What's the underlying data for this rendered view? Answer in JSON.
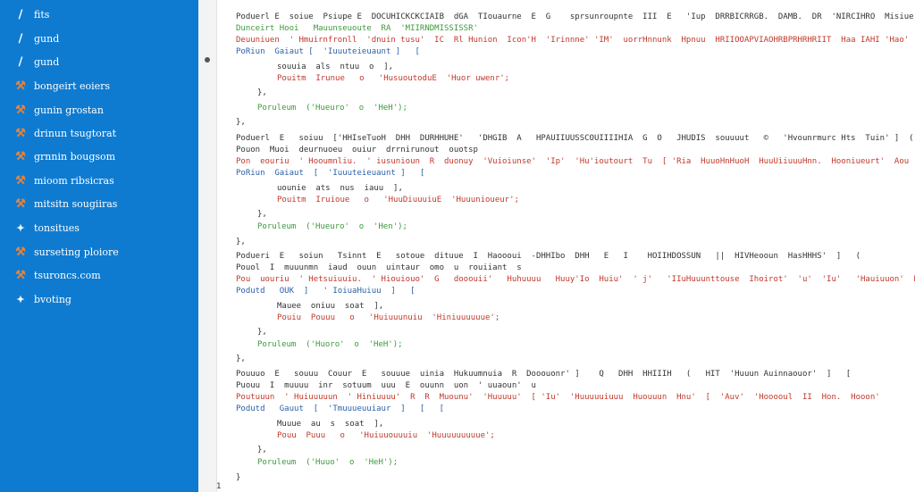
{
  "sidebar": {
    "items": [
      {
        "label": "fits",
        "icon": "pen-icon"
      },
      {
        "label": "gund",
        "icon": "pen-icon"
      },
      {
        "label": "gund",
        "icon": "pen-icon"
      },
      {
        "label": "bongeirt eoiers",
        "icon": "tool-icon"
      },
      {
        "label": "gunin grostan",
        "icon": "tool-icon"
      },
      {
        "label": "drinun tsugtorat",
        "icon": "tool-icon"
      },
      {
        "label": "grnnin bougsom",
        "icon": "tool-icon"
      },
      {
        "label": "mioom ribsicras",
        "icon": "tool-icon"
      },
      {
        "label": "mitsitn sougiiras",
        "icon": "tool-icon"
      },
      {
        "label": "tonsitues",
        "icon": "star-icon"
      },
      {
        "label": "surseting ploiore",
        "icon": "tool-icon"
      },
      {
        "label": "tsuroncs.com",
        "icon": "tool-icon"
      },
      {
        "label": "bvoting",
        "icon": "star-icon"
      }
    ]
  },
  "gutter": {
    "end_marker": "1"
  },
  "code": {
    "block1": {
      "l1": "Poduerl E  soiue  Psiupe E  DOCUHICKCKCIAIB  dGA  TIouaurne  E  G    sprsunroupnte  III  E   'Iup  DRRBICRRGB.  DAMB.  DR  'NIRCIHRO  Misiue - RAUT' I",
      "l2": "Dunceirt Hooi   Mauunseuoute  RA  'MIIRNDMISSISSR'",
      "l3": "Deuuniuen  ' Hmuirnfronll  'dnuin tusu'  IC  Rl Hunion  Icon'H  'Irinnne' 'IM'  uorrHnnunk  Hpnuu  HRIIOOAPVIAOHRBPRHRHRIIT  Haa IAHI 'Hao'  'Maooionrom' 'Ip' 'Hun'  Heirt  Bwwnn",
      "l4": "PoRiun  Gaiaut [  'Iuuuteieuaunt ]   [",
      "l5": "souuia  als  ntuu  o  ],",
      "l6": "Pouitm  Irunue   o   'HusuoutoduE  'Huor uwenr';",
      "l7": "},",
      "l8": "Poruleum  ('Hueuro'  o  'HeH');",
      "l9": "},"
    },
    "block2": {
      "l1": "Poduerl  E   soiuu  ['HHIseTuoH  DHH  DURHHUHE'   'DHGIB  A   HPAUIIUUSSCOUIIIIHIA  G  O   JHUDIS  souuuut   ©   'Hvounrmurc Hts  Tuin' ]  (",
      "l2": "Pouon  Muoi  deurnuoeu  ouiur  drrnirunout  ouotsp",
      "l3": "Pon  eouriu  ' Hooumnliu.  ' iusunioun  R  duonuy  'Vuioiunse'  'Ip'  'Hu'ioutourt  Tu  [ 'Ria  HuuoHnHuoH  HuuUiiuuuHnn.  Hooniueurt'  Aou  Hoioou  'Huiuio  HunnoHi'  Euuu",
      "l4": "PoRiun  Gaiaut  [  'Iuuuteieuaunt ]   [",
      "l5": "uounie  ats  nus  iauu  ],",
      "l6": "Pouitm  Iruioue   o   'HuuDiuuuiuE  'Huuunioueur';",
      "l7": "},",
      "l8": "Poruleum  ('Hueuro'  o  'Hen');",
      "l9": "},"
    },
    "block3": {
      "l1": "Podueri  E   soiun   Tsinnt  E   sotoue  dituue  I  Haoooui  -DHHIbo  DHH   E   I    HOIIHDOSSUN   ||  HIVHeooun  HasHHHS'  ]   (",
      "l2": "Pouol  I  muuunmn  iaud  ouun  uintaur  omo  u  rouiiant  s",
      "l3": "Pou  uouriu  ' Hetsuiuuiu.  ' Hiouiouo'  G   dooouii'   Huhuuuu   Huuy'Io  Huiu'  ' j'   'IIuHuuunttouse  Ihoirot'  'u'  'Iu'   'Hauiuuon'  Hoeot  Haoousoonr';",
      "l4": "Podutd   OUK  ]   ' IoiuaHuiuu  ]   [",
      "l5": "Mauee  oniuu  soat  ],",
      "l6": "Pouiu  Pouuu   o   'Huiuuunuiu  'Hiniuuuuuue';",
      "l7": "},",
      "l8": "Poruleum  ('Huoro'  o  'HeH');",
      "l9": "},"
    },
    "block4": {
      "l1": "Pouuuo  E   souuu  Couur  E   souuue  uinia  Hukuumnuia  R  Dooouonr' ]    Q   DHH  HHIIIH   (   HIT  'Huuun Auinnaouor'  ]   [",
      "l2": "Puouu  I  muuuu  inr  sotuum  uuu  E  ouunn  uon  ' uuaoun'  u",
      "l3": "Poutuuun  ' Huiuuuuun  ' Hiniuuuu'  R  R  Muounu'  'Huuuuu'  [ 'Iu'  'Huuuuuiuuu  Huouuun  Hnu'  [  'Auv'  'Hooooul  II  Hon.  Hooon'",
      "l4": "Podutd   Gauut  [  'Tmuuueuuiaur  ]   [   [",
      "l5": "Muuue  au  s  soat  ],",
      "l6": "Pouu  Puuu   o   'Huiuuouuuiu  'Huuuuuuuuue';",
      "l7": "},",
      "l8": "Poruleum  ('Huuo'  o  'HeH');",
      "l9": "}"
    }
  }
}
